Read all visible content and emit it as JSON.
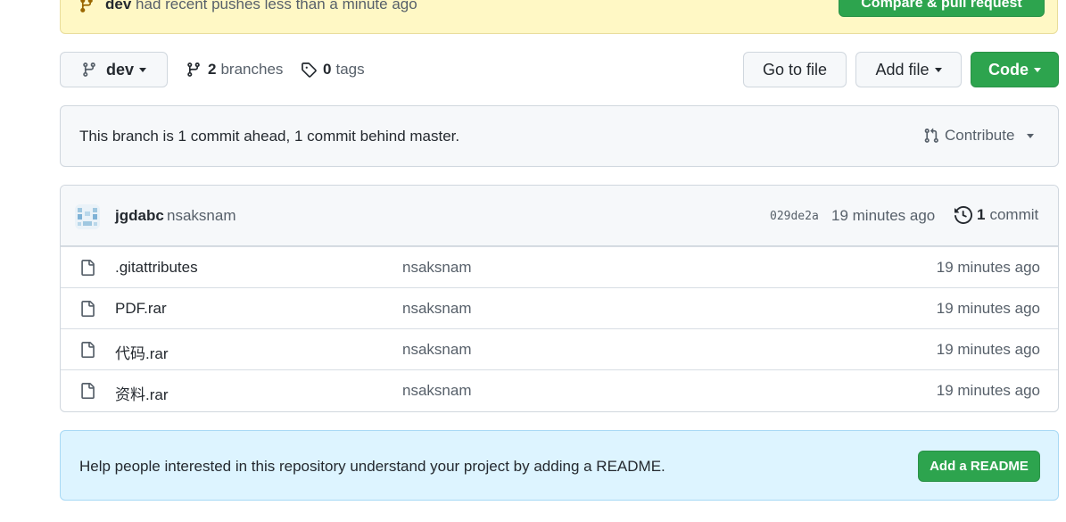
{
  "banner": {
    "branch": "dev",
    "message": "had recent pushes less than a minute ago",
    "compare_label": "Compare & pull request"
  },
  "toolbar": {
    "branch_label": "dev",
    "branches_count": "2",
    "branches_label": "branches",
    "tags_count": "0",
    "tags_label": "tags",
    "goto_label": "Go to file",
    "addfile_label": "Add file",
    "code_label": "Code"
  },
  "branch_status": {
    "text": "This branch is 1 commit ahead, 1 commit behind master.",
    "contribute_label": "Contribute"
  },
  "latest_commit": {
    "author": "jgdabc",
    "message": "nsaksnam",
    "sha": "029de2a",
    "time": "19 minutes ago",
    "commit_count": "1",
    "commit_label": "commit"
  },
  "files": [
    {
      "name": ".gitattributes",
      "message": "nsaksnam",
      "time": "19 minutes ago"
    },
    {
      "name": "PDF.rar",
      "message": "nsaksnam",
      "time": "19 minutes ago"
    },
    {
      "name": "代码.rar",
      "message": "nsaksnam",
      "time": "19 minutes ago"
    },
    {
      "name": "资料.rar",
      "message": "nsaksnam",
      "time": "19 minutes ago"
    }
  ],
  "readme": {
    "text": "Help people interested in this repository understand your project by adding a README.",
    "button_label": "Add a README"
  },
  "colors": {
    "primary_green": "#2da44e",
    "banner_bg": "#fff8c5",
    "readme_bg": "#ddf4ff"
  }
}
